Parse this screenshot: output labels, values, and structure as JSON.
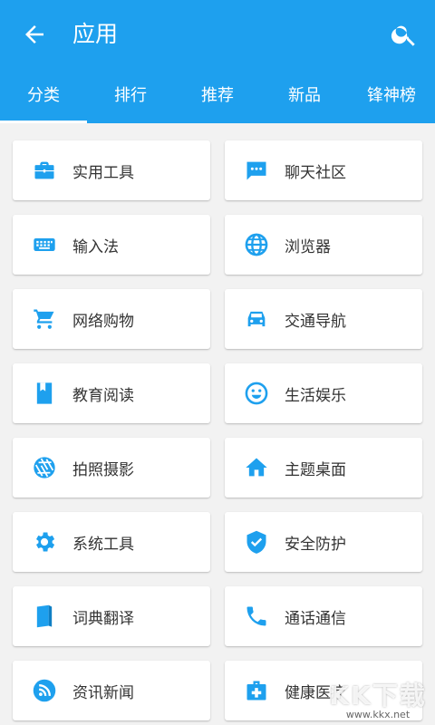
{
  "header": {
    "title": "应用",
    "back_icon": "arrow-left-icon",
    "search_icon": "search-icon"
  },
  "tabs": [
    {
      "label": "分类",
      "active": true
    },
    {
      "label": "排行",
      "active": false
    },
    {
      "label": "推荐",
      "active": false
    },
    {
      "label": "新品",
      "active": false
    },
    {
      "label": "锋神榜",
      "active": false
    }
  ],
  "categories": [
    {
      "label": "实用工具",
      "icon": "briefcase-icon"
    },
    {
      "label": "聊天社区",
      "icon": "chat-icon"
    },
    {
      "label": "输入法",
      "icon": "keyboard-icon"
    },
    {
      "label": "浏览器",
      "icon": "globe-icon"
    },
    {
      "label": "网络购物",
      "icon": "cart-icon"
    },
    {
      "label": "交通导航",
      "icon": "car-icon"
    },
    {
      "label": "教育阅读",
      "icon": "bookmark-icon"
    },
    {
      "label": "生活娱乐",
      "icon": "smiley-icon"
    },
    {
      "label": "拍照摄影",
      "icon": "aperture-icon"
    },
    {
      "label": "主题桌面",
      "icon": "home-icon"
    },
    {
      "label": "系统工具",
      "icon": "gear-icon"
    },
    {
      "label": "安全防护",
      "icon": "shield-icon"
    },
    {
      "label": "词典翻译",
      "icon": "book-icon"
    },
    {
      "label": "通话通信",
      "icon": "phone-icon"
    },
    {
      "label": "资讯新闻",
      "icon": "rss-icon"
    },
    {
      "label": "健康医疗",
      "icon": "medical-kit-icon"
    }
  ],
  "watermark": {
    "logo": "KK下载",
    "url": "www.kkx.net"
  },
  "colors": {
    "primary": "#1ea0ee",
    "icon": "#1ea0ee",
    "background": "#f2f2f2"
  }
}
